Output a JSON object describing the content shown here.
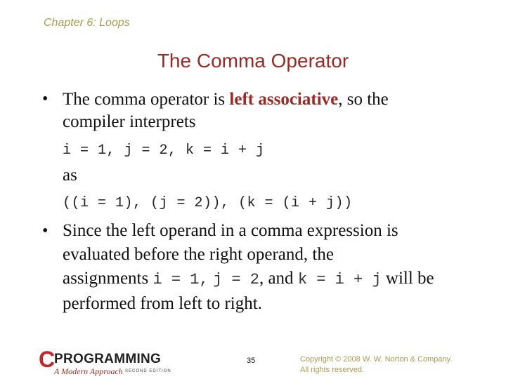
{
  "header": {
    "chapter": "Chapter 6: Loops"
  },
  "slide": {
    "title": "The Comma Operator",
    "bullets": [
      {
        "marker": "•",
        "text_before": "The comma operator is ",
        "highlight": "left associative",
        "text_after_line1": ", so the",
        "line2": "compiler interprets"
      },
      {
        "marker": "•",
        "line1": "Since the left operand in a comma expression is",
        "line2": "evaluated before the right operand, the",
        "line3_prefix": "assignments ",
        "code_a": "i = 1,",
        "code_b": "j = 2",
        "line3_mid": ", and ",
        "code_c": "k = i + j",
        "line3_suffix": " will be",
        "line4": "performed from left to right."
      }
    ],
    "code_line_1": "i = 1, j = 2, k = i + j",
    "as_label": "as",
    "code_line_2": "((i = 1), (j = 2)), (k = (i + j))"
  },
  "footer": {
    "logo_letter": "C",
    "logo_title": "PROGRAMMING",
    "logo_subtitle": "A Modern Approach",
    "logo_edition": "SECOND EDITION",
    "page_number": "35",
    "copyright_line1": "Copyright © 2008 W. W. Norton & Company.",
    "copyright_line2": "All rights reserved."
  }
}
